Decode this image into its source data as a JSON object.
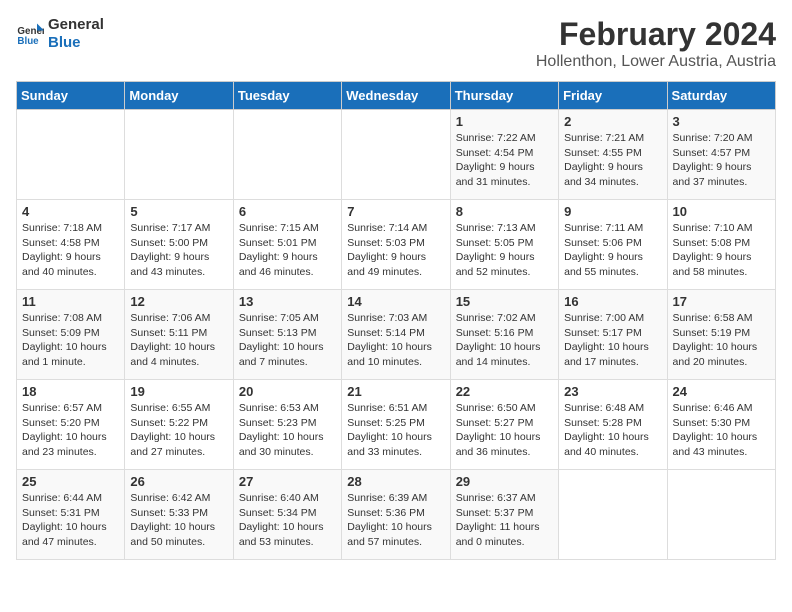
{
  "logo": {
    "line1": "General",
    "line2": "Blue"
  },
  "title": "February 2024",
  "location": "Hollenthon, Lower Austria, Austria",
  "days_of_week": [
    "Sunday",
    "Monday",
    "Tuesday",
    "Wednesday",
    "Thursday",
    "Friday",
    "Saturday"
  ],
  "weeks": [
    [
      {
        "day": "",
        "info": ""
      },
      {
        "day": "",
        "info": ""
      },
      {
        "day": "",
        "info": ""
      },
      {
        "day": "",
        "info": ""
      },
      {
        "day": "1",
        "info": "Sunrise: 7:22 AM\nSunset: 4:54 PM\nDaylight: 9 hours\nand 31 minutes."
      },
      {
        "day": "2",
        "info": "Sunrise: 7:21 AM\nSunset: 4:55 PM\nDaylight: 9 hours\nand 34 minutes."
      },
      {
        "day": "3",
        "info": "Sunrise: 7:20 AM\nSunset: 4:57 PM\nDaylight: 9 hours\nand 37 minutes."
      }
    ],
    [
      {
        "day": "4",
        "info": "Sunrise: 7:18 AM\nSunset: 4:58 PM\nDaylight: 9 hours\nand 40 minutes."
      },
      {
        "day": "5",
        "info": "Sunrise: 7:17 AM\nSunset: 5:00 PM\nDaylight: 9 hours\nand 43 minutes."
      },
      {
        "day": "6",
        "info": "Sunrise: 7:15 AM\nSunset: 5:01 PM\nDaylight: 9 hours\nand 46 minutes."
      },
      {
        "day": "7",
        "info": "Sunrise: 7:14 AM\nSunset: 5:03 PM\nDaylight: 9 hours\nand 49 minutes."
      },
      {
        "day": "8",
        "info": "Sunrise: 7:13 AM\nSunset: 5:05 PM\nDaylight: 9 hours\nand 52 minutes."
      },
      {
        "day": "9",
        "info": "Sunrise: 7:11 AM\nSunset: 5:06 PM\nDaylight: 9 hours\nand 55 minutes."
      },
      {
        "day": "10",
        "info": "Sunrise: 7:10 AM\nSunset: 5:08 PM\nDaylight: 9 hours\nand 58 minutes."
      }
    ],
    [
      {
        "day": "11",
        "info": "Sunrise: 7:08 AM\nSunset: 5:09 PM\nDaylight: 10 hours\nand 1 minute."
      },
      {
        "day": "12",
        "info": "Sunrise: 7:06 AM\nSunset: 5:11 PM\nDaylight: 10 hours\nand 4 minutes."
      },
      {
        "day": "13",
        "info": "Sunrise: 7:05 AM\nSunset: 5:13 PM\nDaylight: 10 hours\nand 7 minutes."
      },
      {
        "day": "14",
        "info": "Sunrise: 7:03 AM\nSunset: 5:14 PM\nDaylight: 10 hours\nand 10 minutes."
      },
      {
        "day": "15",
        "info": "Sunrise: 7:02 AM\nSunset: 5:16 PM\nDaylight: 10 hours\nand 14 minutes."
      },
      {
        "day": "16",
        "info": "Sunrise: 7:00 AM\nSunset: 5:17 PM\nDaylight: 10 hours\nand 17 minutes."
      },
      {
        "day": "17",
        "info": "Sunrise: 6:58 AM\nSunset: 5:19 PM\nDaylight: 10 hours\nand 20 minutes."
      }
    ],
    [
      {
        "day": "18",
        "info": "Sunrise: 6:57 AM\nSunset: 5:20 PM\nDaylight: 10 hours\nand 23 minutes."
      },
      {
        "day": "19",
        "info": "Sunrise: 6:55 AM\nSunset: 5:22 PM\nDaylight: 10 hours\nand 27 minutes."
      },
      {
        "day": "20",
        "info": "Sunrise: 6:53 AM\nSunset: 5:23 PM\nDaylight: 10 hours\nand 30 minutes."
      },
      {
        "day": "21",
        "info": "Sunrise: 6:51 AM\nSunset: 5:25 PM\nDaylight: 10 hours\nand 33 minutes."
      },
      {
        "day": "22",
        "info": "Sunrise: 6:50 AM\nSunset: 5:27 PM\nDaylight: 10 hours\nand 36 minutes."
      },
      {
        "day": "23",
        "info": "Sunrise: 6:48 AM\nSunset: 5:28 PM\nDaylight: 10 hours\nand 40 minutes."
      },
      {
        "day": "24",
        "info": "Sunrise: 6:46 AM\nSunset: 5:30 PM\nDaylight: 10 hours\nand 43 minutes."
      }
    ],
    [
      {
        "day": "25",
        "info": "Sunrise: 6:44 AM\nSunset: 5:31 PM\nDaylight: 10 hours\nand 47 minutes."
      },
      {
        "day": "26",
        "info": "Sunrise: 6:42 AM\nSunset: 5:33 PM\nDaylight: 10 hours\nand 50 minutes."
      },
      {
        "day": "27",
        "info": "Sunrise: 6:40 AM\nSunset: 5:34 PM\nDaylight: 10 hours\nand 53 minutes."
      },
      {
        "day": "28",
        "info": "Sunrise: 6:39 AM\nSunset: 5:36 PM\nDaylight: 10 hours\nand 57 minutes."
      },
      {
        "day": "29",
        "info": "Sunrise: 6:37 AM\nSunset: 5:37 PM\nDaylight: 11 hours\nand 0 minutes."
      },
      {
        "day": "",
        "info": ""
      },
      {
        "day": "",
        "info": ""
      }
    ]
  ]
}
